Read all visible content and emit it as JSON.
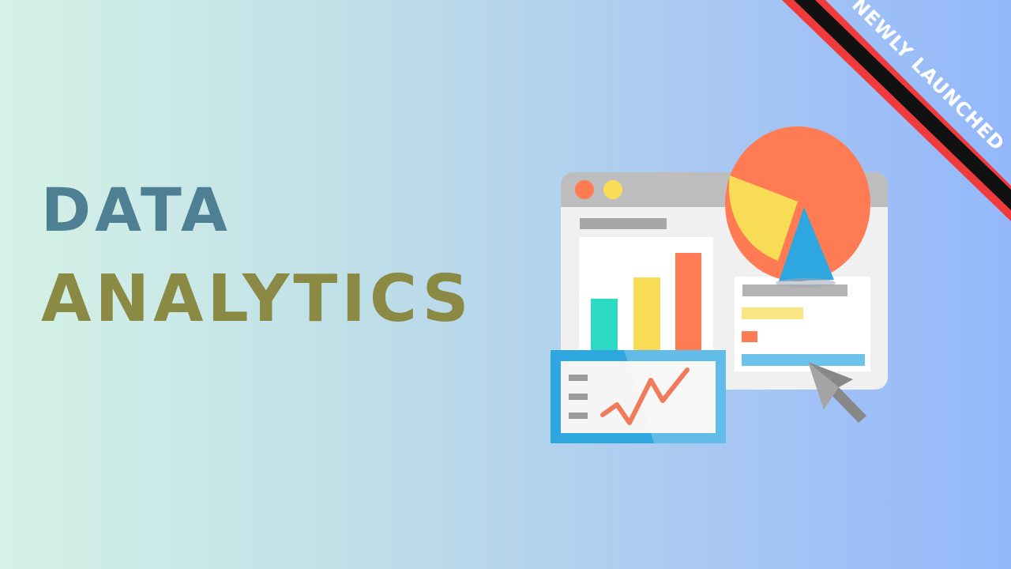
{
  "headline": {
    "line1": "DATA",
    "line2": "ANALYTICS"
  },
  "ribbon": {
    "label": "NEWLY LAUNCHED",
    "color": "#111111",
    "border_color": "#ef3b3b"
  },
  "colors": {
    "line1_text": "#4f7f93",
    "line2_text": "#8b8a45",
    "orange": "#fe7b54",
    "yellow": "#f9dc55",
    "teal": "#2ddbc5",
    "blue": "#2ea6e0",
    "light_blue": "#6cc4ec",
    "gray": "#b8b8b8"
  },
  "illustration": {
    "icons": [
      "analytics-dashboard-icon",
      "pie-chart-icon",
      "bar-chart-icon",
      "line-chart-icon",
      "mouse-cursor-icon"
    ]
  }
}
